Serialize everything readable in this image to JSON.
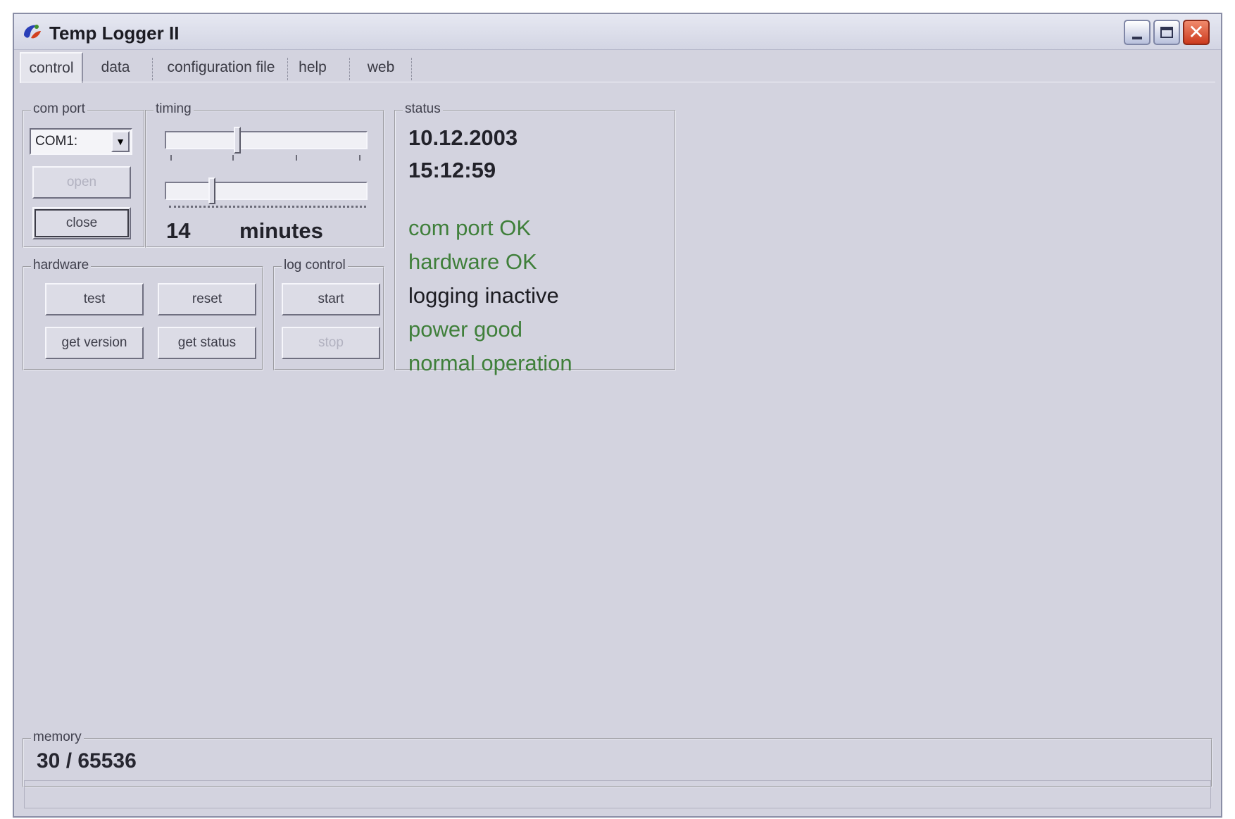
{
  "window": {
    "title": "Temp Logger II",
    "close_symbol": "✕"
  },
  "tabs": [
    {
      "label": "control",
      "active": true
    },
    {
      "label": "data",
      "active": false
    },
    {
      "label": "configuration file",
      "active": false
    },
    {
      "label": "help",
      "active": false
    },
    {
      "label": "web",
      "active": false
    }
  ],
  "com_port": {
    "label": "com port",
    "selected": "COM1:",
    "open_label": "open",
    "close_label": "close"
  },
  "timing": {
    "label": "timing",
    "value": "14",
    "unit": "minutes"
  },
  "hardware": {
    "label": "hardware",
    "test_label": "test",
    "reset_label": "reset",
    "get_version_label": "get version",
    "get_status_label": "get status"
  },
  "log_control": {
    "label": "log control",
    "start_label": "start",
    "stop_label": "stop"
  },
  "status": {
    "label": "status",
    "date": "10.12.2003",
    "time": "15:12:59",
    "messages": [
      {
        "text": "com port OK",
        "color": "#3f7f3a"
      },
      {
        "text": "hardware OK",
        "color": "#3f7f3a"
      },
      {
        "text": "logging inactive",
        "color": "#1c1c22"
      },
      {
        "text": "power good",
        "color": "#3f7f3a"
      },
      {
        "text": "normal operation",
        "color": "#3f7f3a"
      }
    ]
  },
  "memory": {
    "label": "memory",
    "value": "30 / 65536"
  },
  "icons": {
    "app": "app-logo-icon",
    "minimize": "minimize-icon",
    "maximize": "maximize-icon",
    "close": "close-icon",
    "dropdown": "chevron-down-icon"
  }
}
